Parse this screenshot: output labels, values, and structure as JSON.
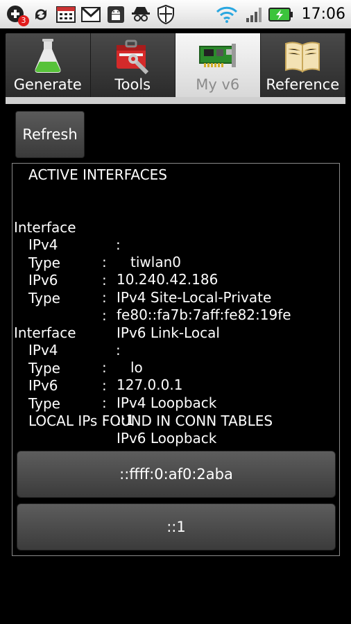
{
  "status_bar": {
    "notification_badge": "3",
    "time": "17:06",
    "icons": [
      "add-notification-icon",
      "sync-icon",
      "calendar-icon",
      "gmail-icon",
      "android-icon",
      "spy-icon",
      "shield-icon",
      "wifi-icon",
      "signal-icon",
      "battery-icon"
    ]
  },
  "tabs": [
    {
      "label": "Generate",
      "icon": "flask-icon",
      "active": false
    },
    {
      "label": "Tools",
      "icon": "toolbox-icon",
      "active": false
    },
    {
      "label": "My v6",
      "icon": "network-card-icon",
      "active": true
    },
    {
      "label": "Reference",
      "icon": "book-icon",
      "active": false
    }
  ],
  "refresh_label": "Refresh",
  "panel": {
    "active_header": "ACTIVE INTERFACES",
    "interfaces": [
      {
        "interface_label": "Interface",
        "name": "tiwlan0",
        "rows": [
          {
            "label": "IPv4",
            "value": "10.240.42.186"
          },
          {
            "label": "Type",
            "value": "IPv4 Site-Local-Private"
          },
          {
            "label": "IPv6",
            "value": "fe80::fa7b:7aff:fe82:19fe"
          },
          {
            "label": "Type",
            "value": "IPv6 Link-Local"
          }
        ]
      },
      {
        "interface_label": "Interface",
        "name": "lo",
        "rows": [
          {
            "label": "IPv4",
            "value": "127.0.0.1"
          },
          {
            "label": "Type",
            "value": "IPv4 Loopback"
          },
          {
            "label": "IPv6",
            "value": "::1"
          },
          {
            "label": "Type",
            "value": "IPv6 Loopback"
          }
        ]
      }
    ],
    "conn_header": "LOCAL IPs FOUND IN CONN TABLES",
    "conn_ips": [
      "::ffff:0:af0:2aba",
      "::1"
    ]
  },
  "colors": {
    "background": "#000000",
    "status_bar": "#f0f0f0",
    "tab_inactive": "#3a3a3a",
    "tab_active": "#e8e8e8",
    "button": "#4a4a4a",
    "text": "#ffffff",
    "battery_green": "#3cc43c"
  }
}
